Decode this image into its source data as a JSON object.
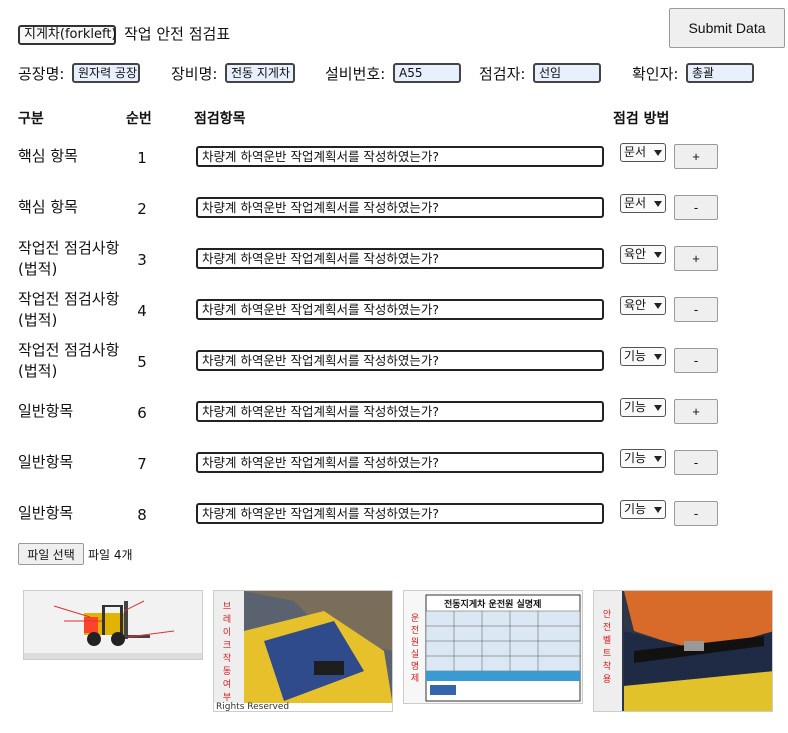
{
  "header": {
    "equipment_select": "지게차(forkleft)",
    "title": "작업 안전 점검표",
    "submit_label": "Submit Data"
  },
  "fields": [
    {
      "label": "공장명:",
      "value": "원자력 공장"
    },
    {
      "label": "장비명:",
      "value": "전동 지게차"
    },
    {
      "label": "설비번호:",
      "value": "A55"
    },
    {
      "label": "점검자:",
      "value": "선임"
    },
    {
      "label": "확인자:",
      "value": "총괄"
    }
  ],
  "table": {
    "headers": {
      "category": "구분",
      "number": "순번",
      "item": "점검항목",
      "method": "점검 방법"
    },
    "rows": [
      {
        "category": "핵심 항목",
        "number": "1",
        "item": "차량계 하역운반 작업계획서를 작성하였는가?",
        "method": "문서",
        "action": "+"
      },
      {
        "category": "핵심 항목",
        "number": "2",
        "item": "차량계 하역운반 작업계획서를 작성하였는가?",
        "method": "문서",
        "action": "-"
      },
      {
        "category": "작업전 점검사항 (법적)",
        "number": "3",
        "item": "차량계 하역운반 작업계획서를 작성하였는가?",
        "method": "육안",
        "action": "+"
      },
      {
        "category": "작업전 점검사항 (법적)",
        "number": "4",
        "item": "차량계 하역운반 작업계획서를 작성하였는가?",
        "method": "육안",
        "action": "-"
      },
      {
        "category": "작업전 점검사항 (법적)",
        "number": "5",
        "item": "차량계 하역운반 작업계획서를 작성하였는가?",
        "method": "기능",
        "action": "-"
      },
      {
        "category": "일반항목",
        "number": "6",
        "item": "차량계 하역운반 작업계획서를 작성하였는가?",
        "method": "기능",
        "action": "+"
      },
      {
        "category": "일반항목",
        "number": "7",
        "item": "차량계 하역운반 작업계획서를 작성하였는가?",
        "method": "기능",
        "action": "-"
      },
      {
        "category": "일반항목",
        "number": "8",
        "item": "차량계 하역운반 작업계획서를 작성하였는가?",
        "method": "기능",
        "action": "-"
      }
    ]
  },
  "file": {
    "button_label": "파일 선택",
    "status": "파일 4개"
  },
  "thumbnails": {
    "thumb2_caption": "브레이크작동여부",
    "thumb2_footer": "Rights Reserved",
    "thumb3_title": "전동지게차 운전원 실명제",
    "thumb3_side": "운전원실명제",
    "thumb4_caption": "안전벨트착용"
  }
}
